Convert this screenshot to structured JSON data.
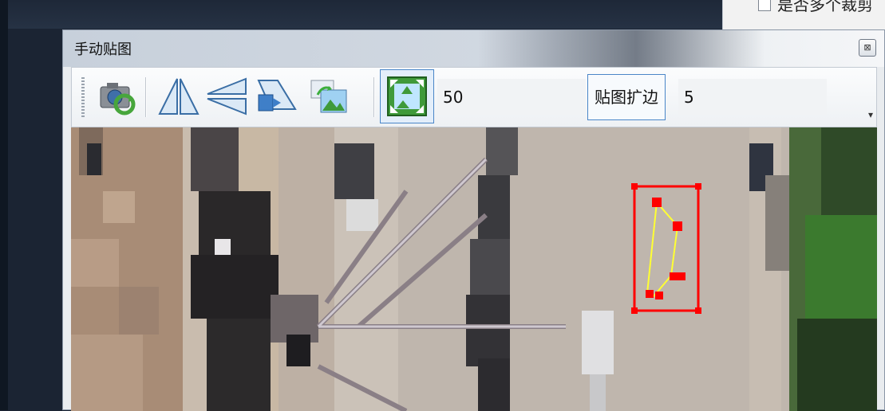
{
  "host": {
    "checkbox_label": "是否多个裁剪"
  },
  "dialog": {
    "title": "手动贴图",
    "close_label": "⊠"
  },
  "toolbar": {
    "buttons": [
      {
        "name": "camera-refresh",
        "icon": "camera-refresh-icon"
      },
      {
        "name": "flip-horizontal",
        "icon": "flip-horizontal-icon"
      },
      {
        "name": "flip-vertical",
        "icon": "flip-vertical-icon"
      },
      {
        "name": "skew",
        "icon": "skew-icon"
      },
      {
        "name": "replace-image",
        "icon": "image-swap-icon"
      },
      {
        "name": "expand",
        "icon": "expand-arrows-icon",
        "active": true
      }
    ],
    "expand_value": "50",
    "edge_label": "贴图扩边",
    "edge_value": "5",
    "overflow_label": "▾"
  },
  "colors": {
    "selection": "#ff0000",
    "polygon": "#ffff33",
    "active_border": "#4a86c8"
  }
}
